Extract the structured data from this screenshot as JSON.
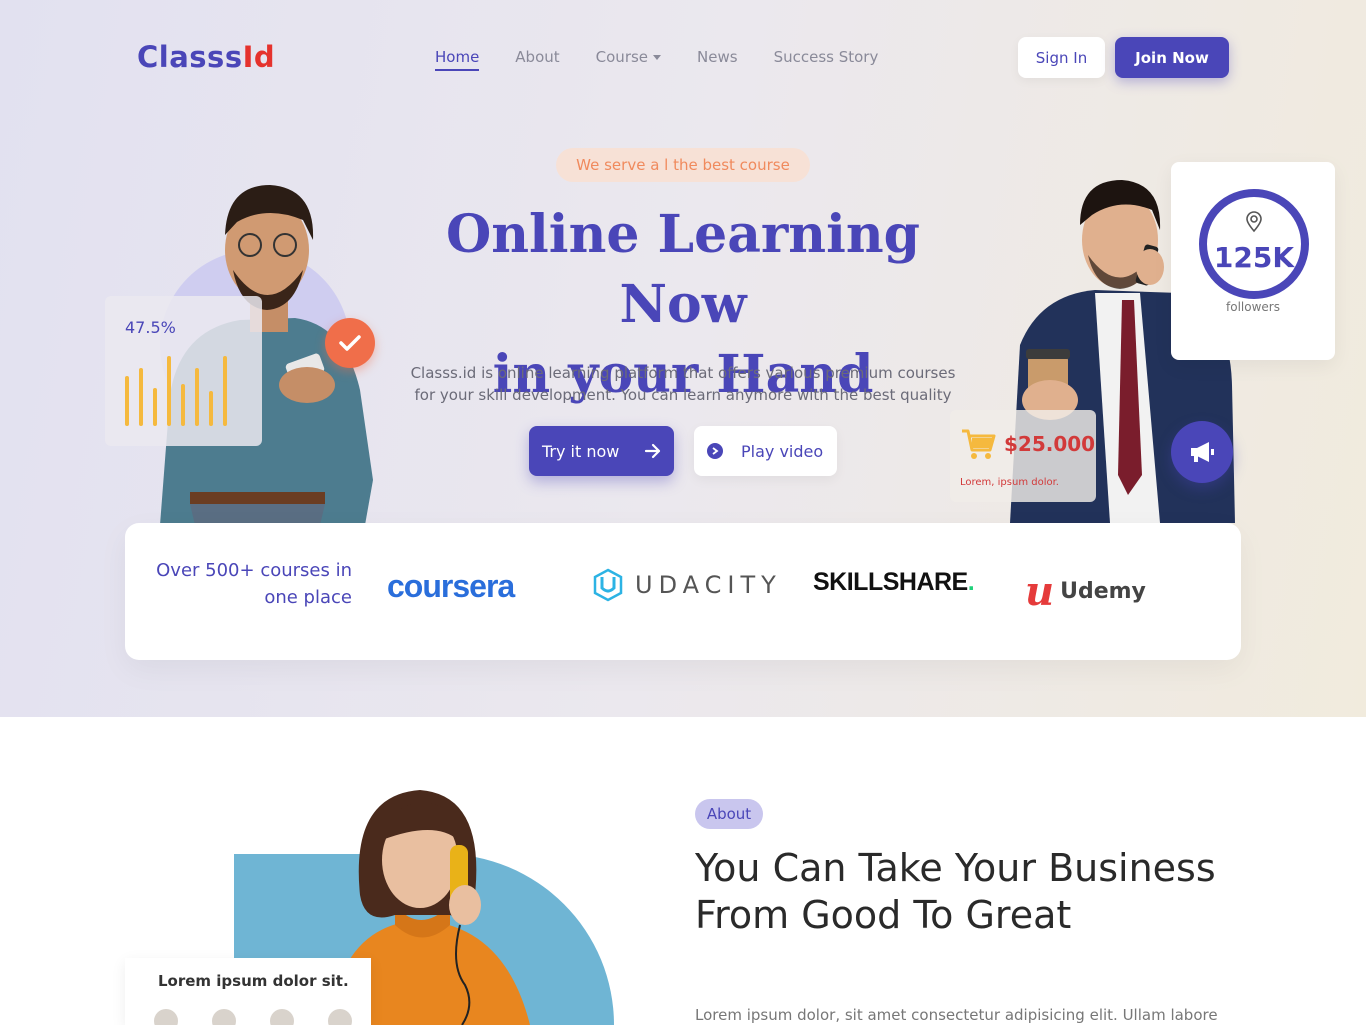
{
  "header": {
    "logo_part1": "Classs",
    "logo_part2": "Id",
    "nav": [
      "Home",
      "About",
      "Course",
      "News",
      "Success Story"
    ],
    "sign_in": "Sign In",
    "join_now": "Join Now"
  },
  "hero": {
    "tagline": "We serve a l the best course",
    "title_line1": "Online Learning Now",
    "title_line2": "in your Hand",
    "description": "Classs.id is online learning platform that offers various premium courses for your skill development. You can learn anymore with the best quality",
    "try_button": "Try it now",
    "play_button": "Play video",
    "stat_percent": "47.5%",
    "followers_count": "125K",
    "followers_label": "followers",
    "price": "$25.000",
    "price_note": "Lorem, ipsum dolor."
  },
  "partners": {
    "text": "Over 500+ courses in one place",
    "brands": [
      "coursera",
      "UDACITY",
      "SKILLSHARE",
      "Udemy"
    ]
  },
  "about": {
    "pill": "About",
    "title": "You Can Take Your Business From Good To Great",
    "text": "Lorem ipsum dolor, sit amet consectetur adipisicing elit. Ullam labore",
    "card_title": "Lorem ipsum dolor sit."
  },
  "colors": {
    "primary": "#4a46b8",
    "accent_red": "#e5322d",
    "orange": "#f06e4a",
    "bar_yellow": "#f5b93e"
  }
}
